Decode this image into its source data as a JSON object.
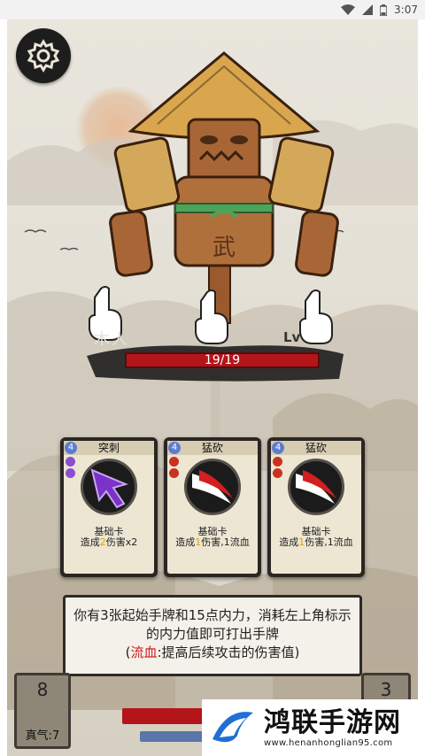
{
  "status_bar": {
    "time": "3:07"
  },
  "enemy": {
    "name": "木人",
    "level_prefix": "Lv",
    "hp_text": "19/19",
    "chest_glyph": "武"
  },
  "cards": [
    {
      "cost": "4",
      "title": "突刺",
      "type": "基础卡",
      "desc_pre": "造成",
      "desc_num": "2",
      "desc_post": "伤害x2",
      "art": "purple-thrust",
      "tag_color": "#8a4fd0"
    },
    {
      "cost": "4",
      "title": "猛砍",
      "type": "基础卡",
      "desc_pre": "造成",
      "desc_num": "1",
      "desc_post": "伤害,1流血",
      "art": "red-slash",
      "tag_color": "#c8321f"
    },
    {
      "cost": "4",
      "title": "猛砍",
      "type": "基础卡",
      "desc_pre": "造成",
      "desc_num": "1",
      "desc_post": "伤害,1流血",
      "art": "red-slash",
      "tag_color": "#c8321f"
    }
  ],
  "dialog": {
    "line1": "你有3张起始手牌和15点内力，消耗左上角标示的内力值即可打出手牌",
    "paren_open": "(",
    "bleed_word": "流血",
    "line2_rest": ":提高后续攻击的伤害值)"
  },
  "player": {
    "energy_value": "8",
    "energy_label": "真气:7",
    "deck_count": "3"
  },
  "watermark": {
    "title": "鸿联手游网",
    "url": "www.henanhonglian95.com"
  },
  "colors": {
    "hp_red": "#b3151a",
    "mp_blue": "#5b76a8",
    "cost_blue": "#5e7bd1",
    "highlight_yellow": "#d9a400",
    "bleed_red": "#d11515"
  },
  "icons": [
    "wifi-icon",
    "signal-icon",
    "battery-icon",
    "settings-gear-icon",
    "pointing-hand-icon",
    "watermark-logo-icon"
  ]
}
